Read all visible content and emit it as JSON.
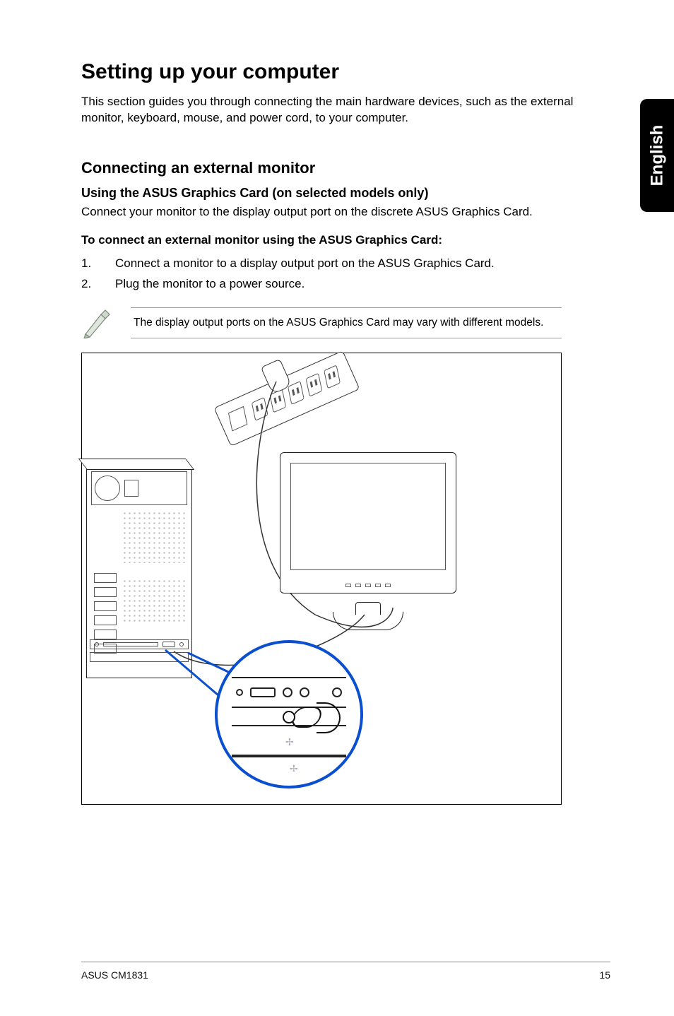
{
  "side_tab": "English",
  "title": "Setting up your computer",
  "intro": "This section guides you through connecting the main hardware devices, such as the external monitor, keyboard, mouse, and power cord, to your computer.",
  "section": {
    "heading": "Connecting an external monitor",
    "subheading": "Using the ASUS Graphics Card (on selected models only)",
    "sub_intro": "Connect your monitor to the display output port on the discrete ASUS Graphics Card.",
    "proc_title": "To connect an external monitor using the ASUS Graphics Card:",
    "steps": [
      {
        "num": "1.",
        "text": "Connect a monitor to a display output port on the ASUS Graphics Card."
      },
      {
        "num": "2.",
        "text": "Plug the monitor to a power source."
      }
    ],
    "note": "The display output ports on the ASUS Graphics Card may vary with different models."
  },
  "footer": {
    "left": "ASUS CM1831",
    "right": "15"
  }
}
